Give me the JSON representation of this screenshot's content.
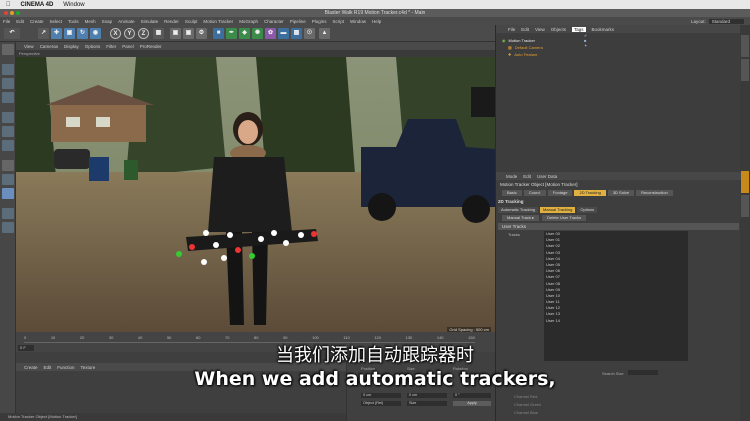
{
  "os_menu": {
    "app_name": "CINEMA 4D",
    "window_menu": "Window"
  },
  "window": {
    "title": "Blaster Walk R19 Motion Tracker.c4d * - Main"
  },
  "main_menu": {
    "items": [
      "File",
      "Edit",
      "Create",
      "Select",
      "Tools",
      "Mesh",
      "Snap",
      "Animate",
      "Simulate",
      "Render",
      "Sculpt",
      "Motion Tracker",
      "MoGraph",
      "Character",
      "Pipeline",
      "Plugins",
      "Script",
      "Window",
      "Help"
    ],
    "layout_label": "Layout:",
    "layout_value": "Standard"
  },
  "toolbar": {
    "axis_buttons": [
      "X",
      "Y",
      "Z"
    ]
  },
  "viewport": {
    "menu": [
      "View",
      "Cameras",
      "Display",
      "Options",
      "Filter",
      "Panel",
      "ProRender"
    ],
    "label": "Perspective",
    "grid_spacing": "Grid Spacing : 500 cm"
  },
  "timeline": {
    "ticks": [
      "0",
      "10",
      "20",
      "30",
      "40",
      "50",
      "60",
      "70",
      "80",
      "90",
      "100",
      "110",
      "120",
      "130",
      "140",
      "150"
    ],
    "current_frame": "0 F"
  },
  "material_manager": {
    "menu": [
      "Create",
      "Edit",
      "Function",
      "Texture"
    ]
  },
  "status_bar": {
    "text": "Motion Tracker Object [Motion Tracker]"
  },
  "coordinates": {
    "fields": [
      "0 cm",
      "0 cm",
      "0 °"
    ],
    "mode": "Object (Rel)",
    "size_mode": "Size",
    "apply": "Apply",
    "labels": [
      "Position",
      "Size",
      "Rotation"
    ]
  },
  "object_manager": {
    "menu": [
      "File",
      "Edit",
      "View",
      "Objects",
      "Tags",
      "Bookmarks"
    ],
    "highlighted": "Tags",
    "objects": [
      "Motion Tracker",
      "Default Camera",
      "Auto Feature"
    ]
  },
  "attribute_manager": {
    "menu": [
      "Mode",
      "Edit",
      "User Data"
    ],
    "title": "Motion Tracker Object [Motion Tracker]",
    "tabs": [
      "Basic",
      "Coord.",
      "Footage",
      "2D Tracking",
      "3D Solve",
      "Reconstruction"
    ],
    "active_tab": "2D Tracking",
    "section": "2D Tracking",
    "modes": [
      "Automatic Tracking",
      "Manual Tracking",
      "Options"
    ],
    "active_mode": "Manual Tracking",
    "action_buttons": [
      "Manual Track ▸",
      "Delete User Tracks"
    ],
    "user_tracks_header": "User Tracks",
    "tracks_label": "Tracks",
    "tracks": [
      "User 00",
      "User 01",
      "User 02",
      "User 03",
      "User 04",
      "User 05",
      "User 06",
      "User 07",
      "User 08",
      "User 09",
      "User 10",
      "User 11",
      "User 12",
      "User 13",
      "User 14"
    ],
    "search_size_label": "Search Size",
    "channel_labels": [
      "Channel Red",
      "Channel Green",
      "Channel Blue"
    ]
  },
  "subtitles": {
    "chinese": "当我们添加自动跟踪器时",
    "english": "When we add automatic trackers,"
  },
  "colors": {
    "accent": "#e0b040",
    "object_orange": "#e8a030",
    "object_green": "#7cc040"
  }
}
